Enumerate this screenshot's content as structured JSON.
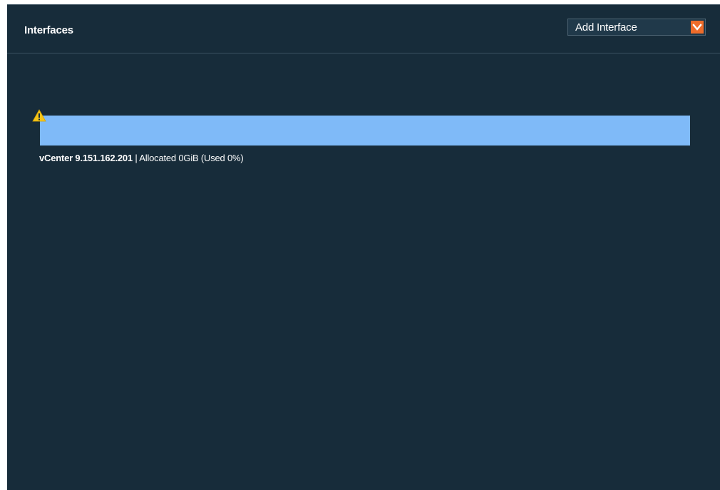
{
  "header": {
    "title": "Interfaces",
    "add_interface_label": "Add Interface",
    "dropdown_icon": "chevron-down-icon",
    "accent_color": "#ef6c2a"
  },
  "interfaces": [
    {
      "name": "vCenter 9.151.162.201",
      "separator": "|",
      "allocation": "Allocated 0GiB (Used 0%)",
      "used_fraction": 0,
      "status_icon": "warning-icon",
      "status_color": "#f5c518",
      "bar_color": "#7fbaf8"
    }
  ],
  "colors": {
    "panel_background": "#172c3a"
  }
}
